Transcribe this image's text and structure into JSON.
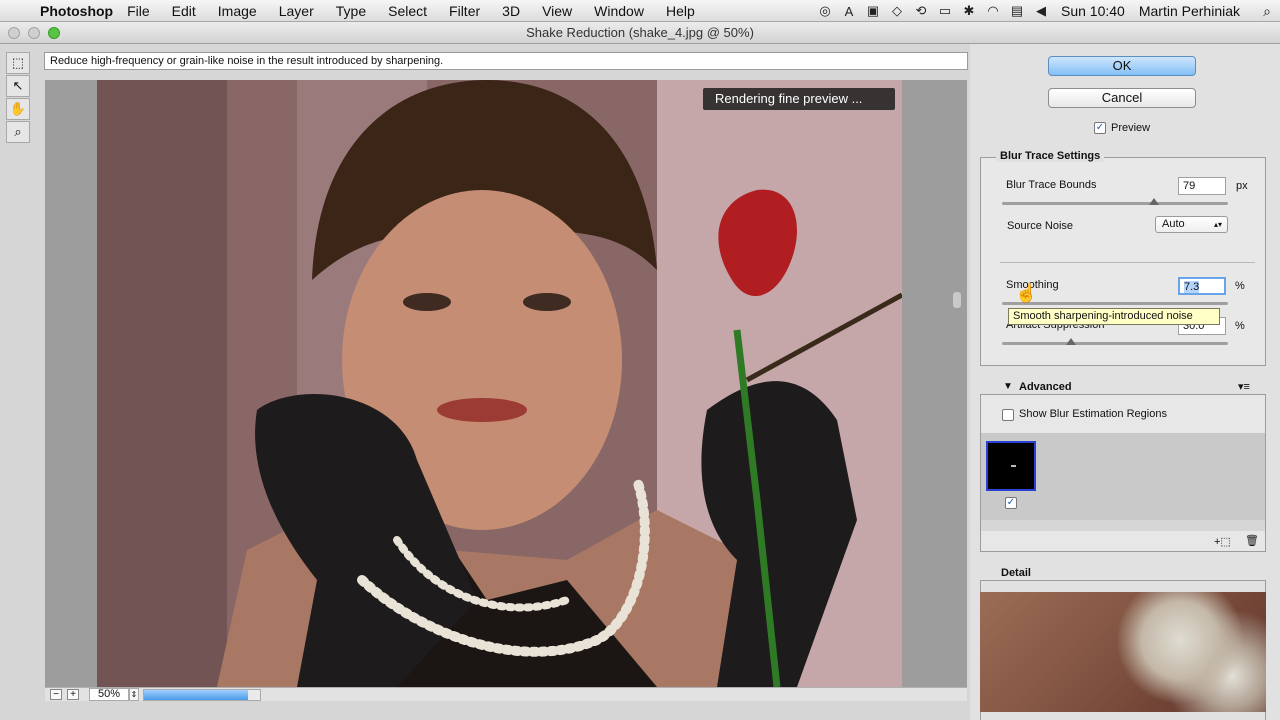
{
  "menubar": {
    "apple": "",
    "app": "Photoshop",
    "items": [
      "File",
      "Edit",
      "Image",
      "Layer",
      "Type",
      "Select",
      "Filter",
      "3D",
      "View",
      "Window",
      "Help"
    ],
    "clock": "Sun 10:40",
    "user": "Martin Perhiniak",
    "tray_icons": [
      "creative-cloud-icon",
      "acrobat-icon",
      "facetime-icon",
      "dropbox-icon",
      "time-machine-icon",
      "display-icon",
      "bluetooth-icon",
      "wifi-icon",
      "flag-icon",
      "volume-icon"
    ]
  },
  "window": {
    "title": "Shake Reduction (shake_4.jpg @ 50%)"
  },
  "hint": "Reduce high-frequency or grain-like noise in the result introduced by sharpening.",
  "canvas": {
    "render_badge": "Rendering fine preview ..."
  },
  "status": {
    "zoom": "50%",
    "progress": 0.9
  },
  "panel": {
    "ok": "OK",
    "cancel": "Cancel",
    "preview_label": "Preview",
    "preview_checked": true,
    "blur_trace": {
      "title": "Blur Trace Settings",
      "bounds_label": "Blur Trace Bounds",
      "bounds_value": "79",
      "bounds_unit": "px",
      "source_noise_label": "Source Noise",
      "source_noise_value": "Auto",
      "smoothing_label": "Smoothing",
      "smoothing_value": "7.3",
      "smoothing_unit": "%",
      "artifact_label": "Artifact Suppression",
      "artifact_value": "30.0",
      "artifact_unit": "%"
    },
    "tooltip": "Smooth sharpening-introduced noise",
    "advanced": {
      "title": "Advanced",
      "show_regions_label": "Show Blur Estimation Regions"
    },
    "detail": {
      "title": "Detail"
    }
  }
}
